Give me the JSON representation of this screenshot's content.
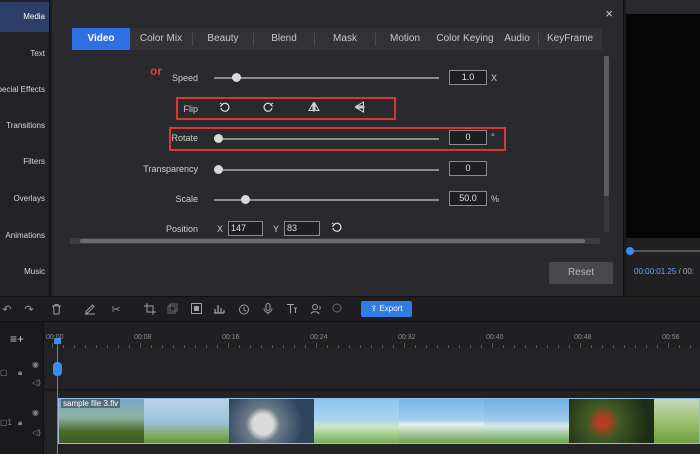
{
  "sidebar": {
    "items": [
      {
        "label": "Media",
        "active": true
      },
      {
        "label": "Text"
      },
      {
        "label": "Special Effects"
      },
      {
        "label": "Transitions"
      },
      {
        "label": "Filters"
      },
      {
        "label": "Overlays"
      },
      {
        "label": "Animations"
      },
      {
        "label": "Music"
      }
    ]
  },
  "dialog": {
    "close_label": "×",
    "tabs": [
      {
        "label": "Video",
        "active": true
      },
      {
        "label": "Color Mix"
      },
      {
        "label": "Beauty"
      },
      {
        "label": "Blend"
      },
      {
        "label": "Mask"
      },
      {
        "label": "Motion"
      },
      {
        "label": "Color Keying"
      },
      {
        "label": "Audio"
      },
      {
        "label": "KeyFrame"
      }
    ],
    "speed": {
      "label": "Speed",
      "value": "1.0",
      "unit": "X",
      "level": 0.08
    },
    "flip": {
      "label": "Flip"
    },
    "or_label": "or",
    "rotate": {
      "label": "Rotate",
      "value": "0",
      "unit": "°",
      "level": 0.0
    },
    "transparency": {
      "label": "Transparency",
      "value": "0",
      "level": 0.0
    },
    "scale": {
      "label": "Scale",
      "value": "50.0",
      "unit": "%",
      "level": 0.12
    },
    "position": {
      "label": "Position",
      "x_label": "X",
      "x_value": "147",
      "y_label": "Y",
      "y_value": "83"
    },
    "reset_label": "Reset"
  },
  "preview": {
    "current_time": "00:00:01.25",
    "separator": " / 00:"
  },
  "toolbar": {
    "export_label": "Export"
  },
  "timeline": {
    "ruler_labels": [
      "00:00",
      "00:08",
      "00:16",
      "00:24",
      "00:32",
      "00:40",
      "00:48",
      "00:56"
    ],
    "clip_name": "sample file 3.flv"
  },
  "colors": {
    "accent": "#2f6fe4",
    "highlight_box": "#d93636",
    "playhead": "#3b8cf5"
  }
}
